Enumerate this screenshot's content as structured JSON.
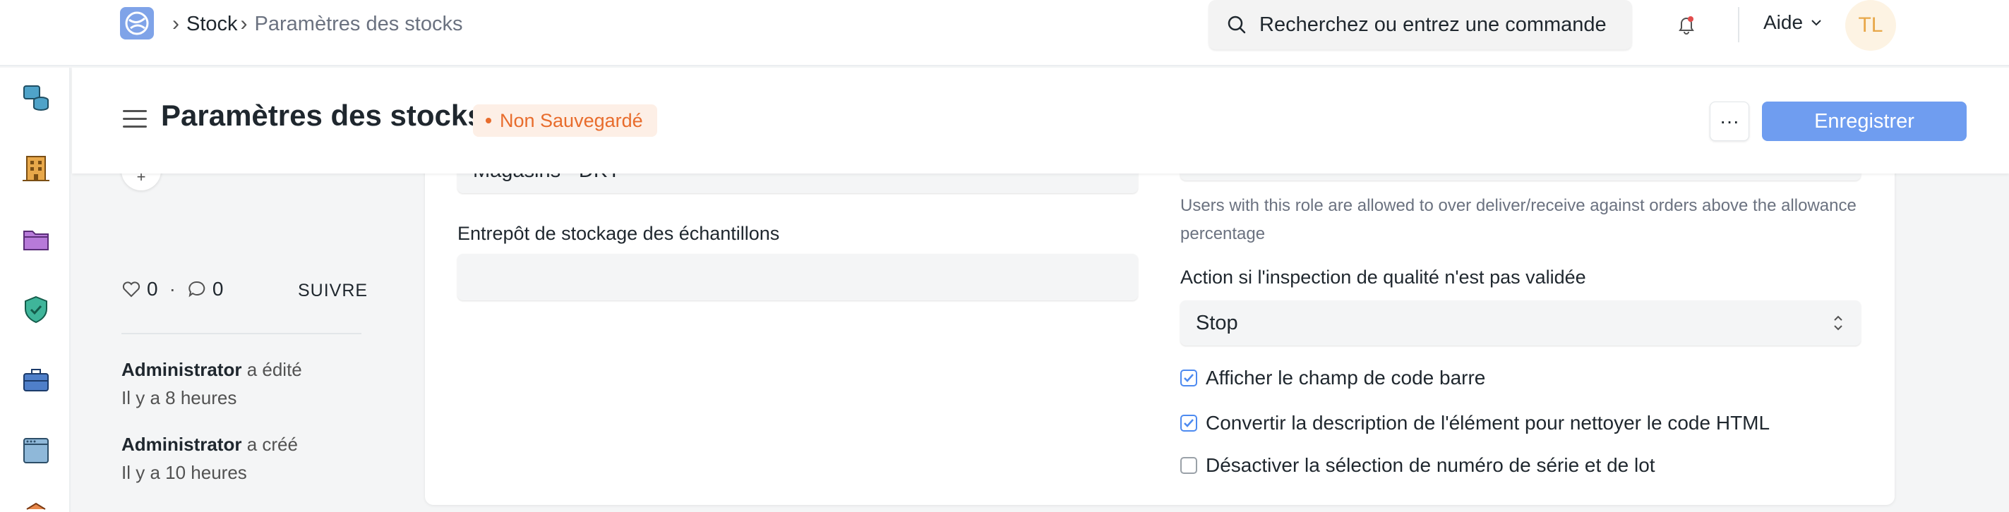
{
  "navbar": {
    "breadcrumb": [
      "Stock",
      "Paramètres des stocks"
    ],
    "search_placeholder": "Recherchez ou entrez une commande",
    "help_label": "Aide",
    "avatar_initials": "TL"
  },
  "sidebar": {
    "icons": [
      "stock-icon",
      "buildings-icon",
      "folder-icon",
      "shield-check-icon",
      "briefcase-icon",
      "window-icon"
    ]
  },
  "header": {
    "title": "Paramètres des stocks",
    "status_badge": "Non Sauvegardé",
    "more_label": "···",
    "save_label": "Enregistrer"
  },
  "left_panel": {
    "likes": "0",
    "comments": "0",
    "separator": "·",
    "follow_label": "SUIVRE",
    "activity": [
      {
        "user": "Administrator",
        "action": "a édité",
        "time": "Il y a 8 heures"
      },
      {
        "user": "Administrator",
        "action": "a créé",
        "time": "Il y a 10 heures"
      }
    ]
  },
  "form": {
    "left": {
      "warehouse_value": "Magasins - DKY",
      "sample_warehouse_label": "Entrepôt de stockage des échantillons",
      "sample_warehouse_value": ""
    },
    "right": {
      "role_description": "Users with this role are allowed to over deliver/receive against orders above the allowance percentage",
      "qi_action_label": "Action si l'inspection de qualité n'est pas validée",
      "qi_action_value": "Stop",
      "checkboxes": [
        {
          "label": "Afficher le champ de code barre",
          "checked": true
        },
        {
          "label": "Convertir la description de l'élément pour nettoyer le code HTML",
          "checked": true
        },
        {
          "label": "Désactiver la sélection de numéro de série et de lot",
          "checked": false
        }
      ]
    }
  },
  "colors": {
    "primary": "#6f9df0",
    "unsaved_text": "#e86c2c",
    "unsaved_bg": "#fdefe6",
    "avatar_bg": "#fdf3e3"
  }
}
